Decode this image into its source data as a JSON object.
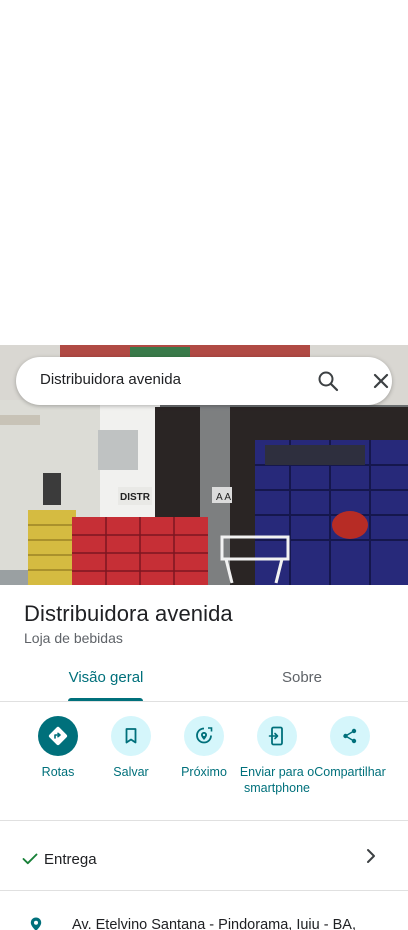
{
  "search": {
    "query": "Distribuidora avenida"
  },
  "place": {
    "title": "Distribuidora avenida",
    "category": "Loja de bebidas",
    "photo_sign": "DISTR"
  },
  "tabs": [
    {
      "label": "Visão geral",
      "selected": true
    },
    {
      "label": "Sobre",
      "selected": false
    }
  ],
  "actions": [
    {
      "label": "Rotas",
      "icon": "directions-icon"
    },
    {
      "label": "Salvar",
      "icon": "bookmark-icon"
    },
    {
      "label": "Próximo",
      "icon": "nearby-icon"
    },
    {
      "label": "Enviar para o smartphone",
      "icon": "send-to-phone-icon"
    },
    {
      "label": "Compartilhar",
      "icon": "share-icon"
    }
  ],
  "service": {
    "label": "Entrega",
    "icon": "check-icon"
  },
  "address": {
    "text": "Av. Etelvino Santana - Pindorama, Iuiu - BA,",
    "icon": "location-pin-icon"
  },
  "colors": {
    "accent": "#00707b",
    "chip": "#d5f6fb",
    "divider": "#e0e0e0"
  }
}
